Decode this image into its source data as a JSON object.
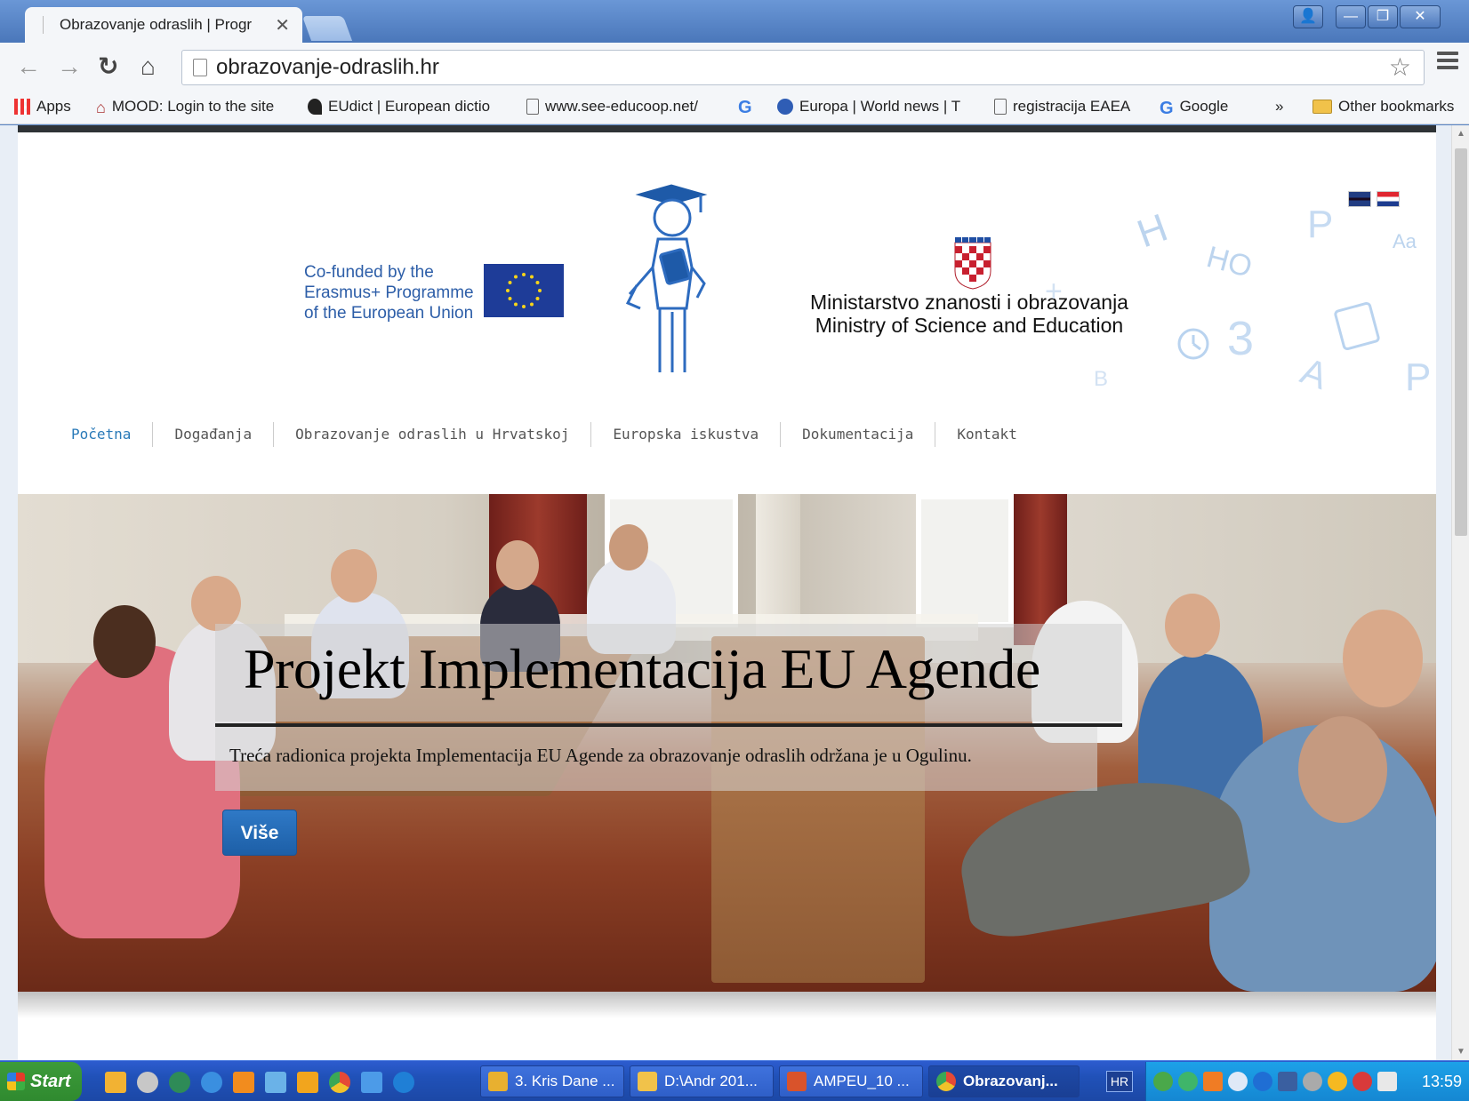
{
  "browser": {
    "tab_title": "Obrazovanje odraslih | Progr",
    "url": "obrazovanje-odraslih.hr",
    "bookmarks": [
      {
        "label": "Apps",
        "icon": "apps-icon"
      },
      {
        "label": "MOOD: Login to the site",
        "icon": "mood-icon"
      },
      {
        "label": "EUdict | European dictio",
        "icon": "eudict-icon"
      },
      {
        "label": "www.see-educoop.net/",
        "icon": "page-icon"
      },
      {
        "label": "",
        "icon": "google-icon"
      },
      {
        "label": "Europa | World news | T",
        "icon": "europa-icon"
      },
      {
        "label": "registracija EAEA",
        "icon": "page-icon"
      },
      {
        "label": "Google",
        "icon": "google-icon"
      },
      {
        "label": "»",
        "icon": "more-icon"
      },
      {
        "label": "Other bookmarks",
        "icon": "folder-icon"
      }
    ]
  },
  "header": {
    "eu_funding_line1": "Co-funded by the",
    "eu_funding_line2": "Erasmus+ Programme",
    "eu_funding_line3": "of the European Union",
    "ministry_line1": "Ministarstvo znanosti i obrazovanja",
    "ministry_line2": "Ministry of Science and Education"
  },
  "nav": {
    "items": [
      "Početna",
      "Događanja",
      "Obrazovanje odraslih u Hrvatskoj",
      "Europska iskustva",
      "Dokumentacija",
      "Kontakt"
    ]
  },
  "hero": {
    "title": "Projekt Implementacija EU Agende",
    "text": "Treća radionica projekta Implementacija EU Agende za obrazovanje odraslih održana je u Ogulinu.",
    "button_label": "Više"
  },
  "taskbar": {
    "start_label": "Start",
    "tasks": [
      {
        "label": "3. Kris Dane ...",
        "color": "#e8b030"
      },
      {
        "label": "D:\\Andr 201...",
        "color": "#f1c24a"
      },
      {
        "label": "AMPEU_10 ...",
        "color": "#d9532b"
      },
      {
        "label": "Obrazovanj...",
        "color": "#e54a36"
      }
    ],
    "language": "HR",
    "clock": "13:59"
  },
  "colors": {
    "nav_active": "#2a7ab8",
    "button_blue": "#2f79c6",
    "eu_blue": "#1e3c98"
  }
}
